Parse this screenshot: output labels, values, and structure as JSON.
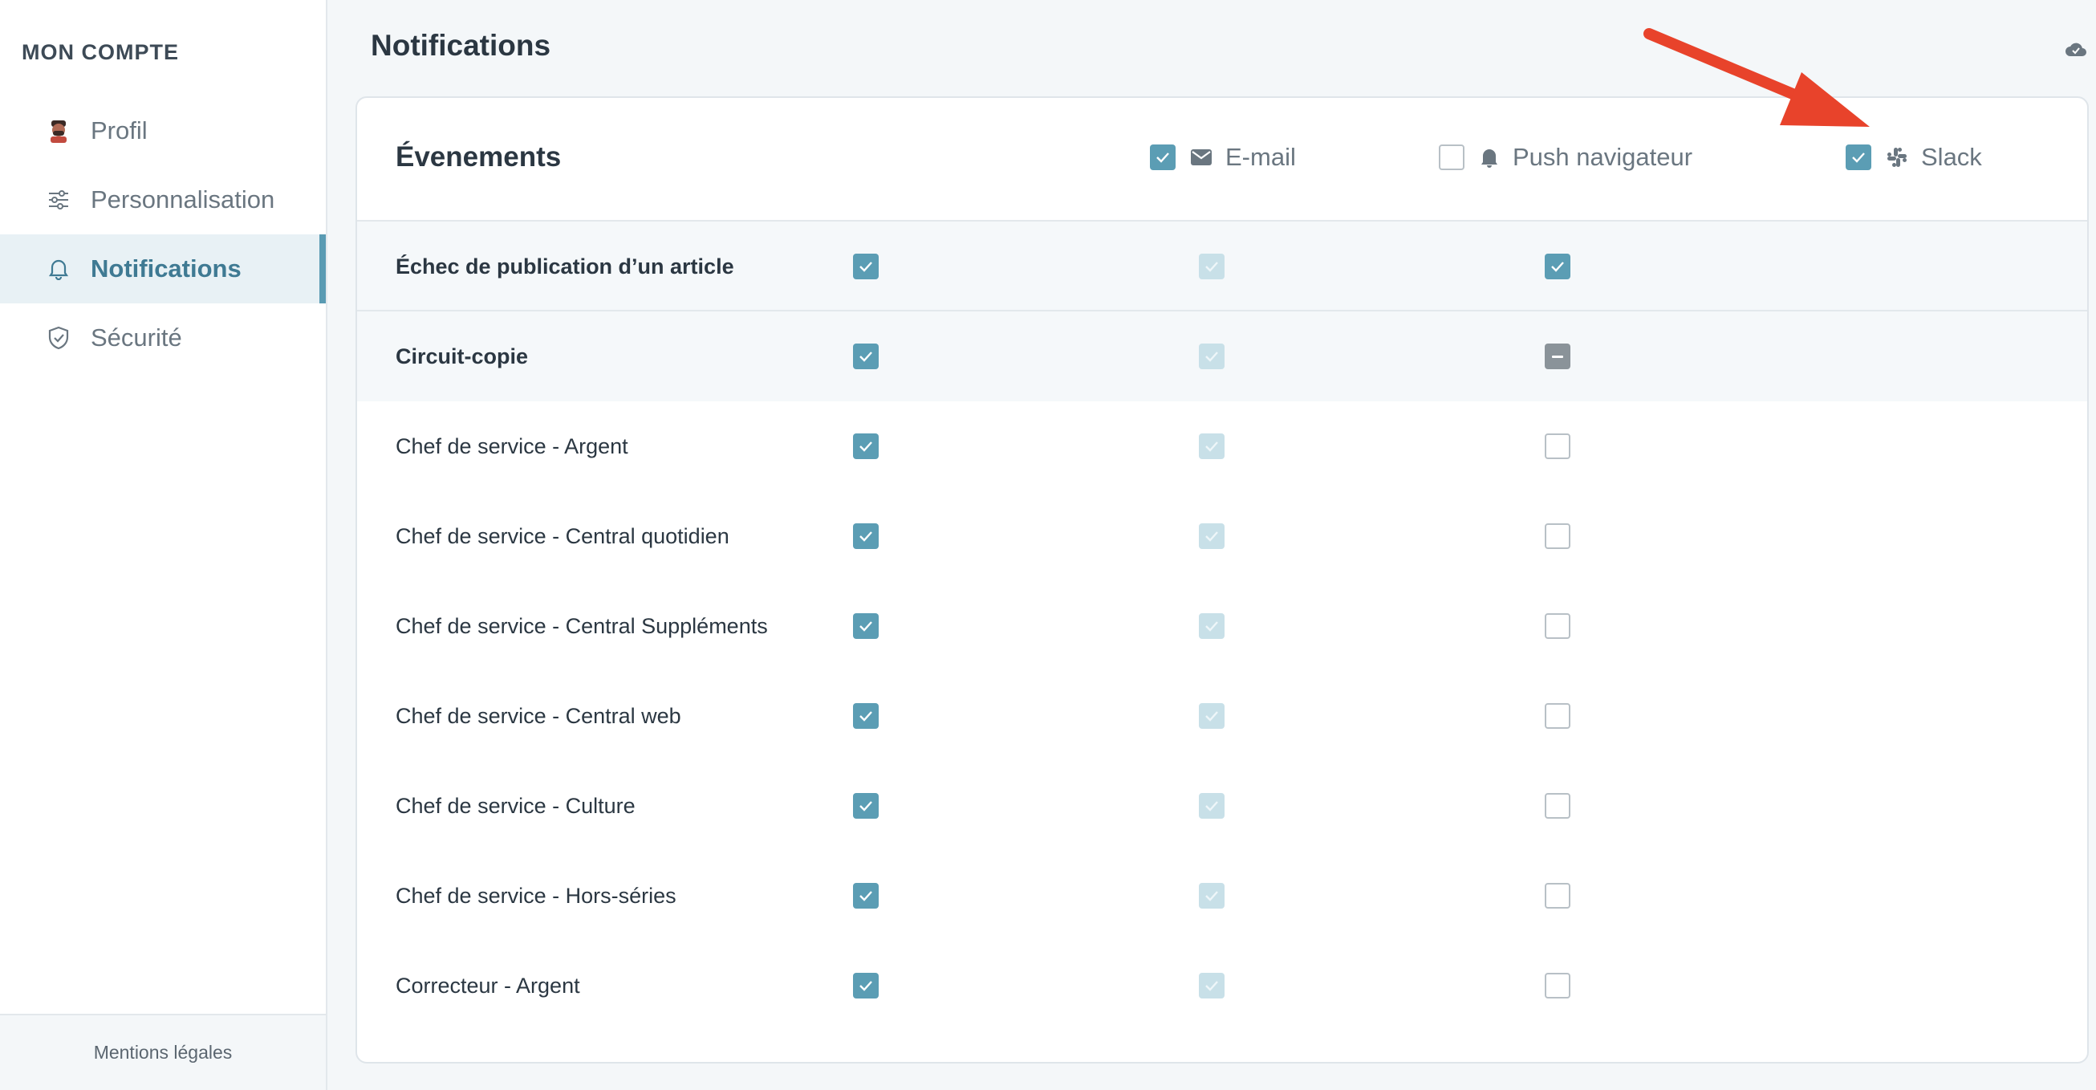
{
  "sidebar": {
    "title": "MON COMPTE",
    "items": [
      {
        "label": "Profil",
        "icon": "avatar-icon"
      },
      {
        "label": "Personnalisation",
        "icon": "sliders-icon"
      },
      {
        "label": "Notifications",
        "icon": "bell-icon",
        "active": true
      },
      {
        "label": "Sécurité",
        "icon": "shield-icon"
      }
    ],
    "footer": "Mentions légales"
  },
  "header": {
    "title": "Notifications"
  },
  "table": {
    "title": "Évenements",
    "columns": [
      {
        "label": "E-mail",
        "icon": "mail-icon",
        "checked": true
      },
      {
        "label": "Push navigateur",
        "icon": "bell-icon",
        "checked": false
      },
      {
        "label": "Slack",
        "icon": "slack-icon",
        "checked": true
      }
    ],
    "rows": [
      {
        "label": "Échec de publication d’un article",
        "email": "checked",
        "push": "light",
        "slack": "checked",
        "group": true
      },
      {
        "label": "Circuit-copie",
        "email": "checked",
        "push": "light",
        "slack": "indeterminate",
        "group": true
      },
      {
        "label": "Chef de service - Argent",
        "email": "checked",
        "push": "light",
        "slack": "empty"
      },
      {
        "label": "Chef de service - Central quotidien",
        "email": "checked",
        "push": "light",
        "slack": "empty"
      },
      {
        "label": "Chef de service - Central Suppléments",
        "email": "checked",
        "push": "light",
        "slack": "empty"
      },
      {
        "label": "Chef de service - Central web",
        "email": "checked",
        "push": "light",
        "slack": "empty"
      },
      {
        "label": "Chef de service - Culture",
        "email": "checked",
        "push": "light",
        "slack": "empty"
      },
      {
        "label": "Chef de service - Hors-séries",
        "email": "checked",
        "push": "light",
        "slack": "empty"
      },
      {
        "label": "Correcteur - Argent",
        "email": "checked",
        "push": "light",
        "slack": "empty"
      }
    ]
  },
  "colors": {
    "accent": "#5b9db4",
    "accent_light": "#c8e0e8",
    "arrow": "#e8432b"
  }
}
